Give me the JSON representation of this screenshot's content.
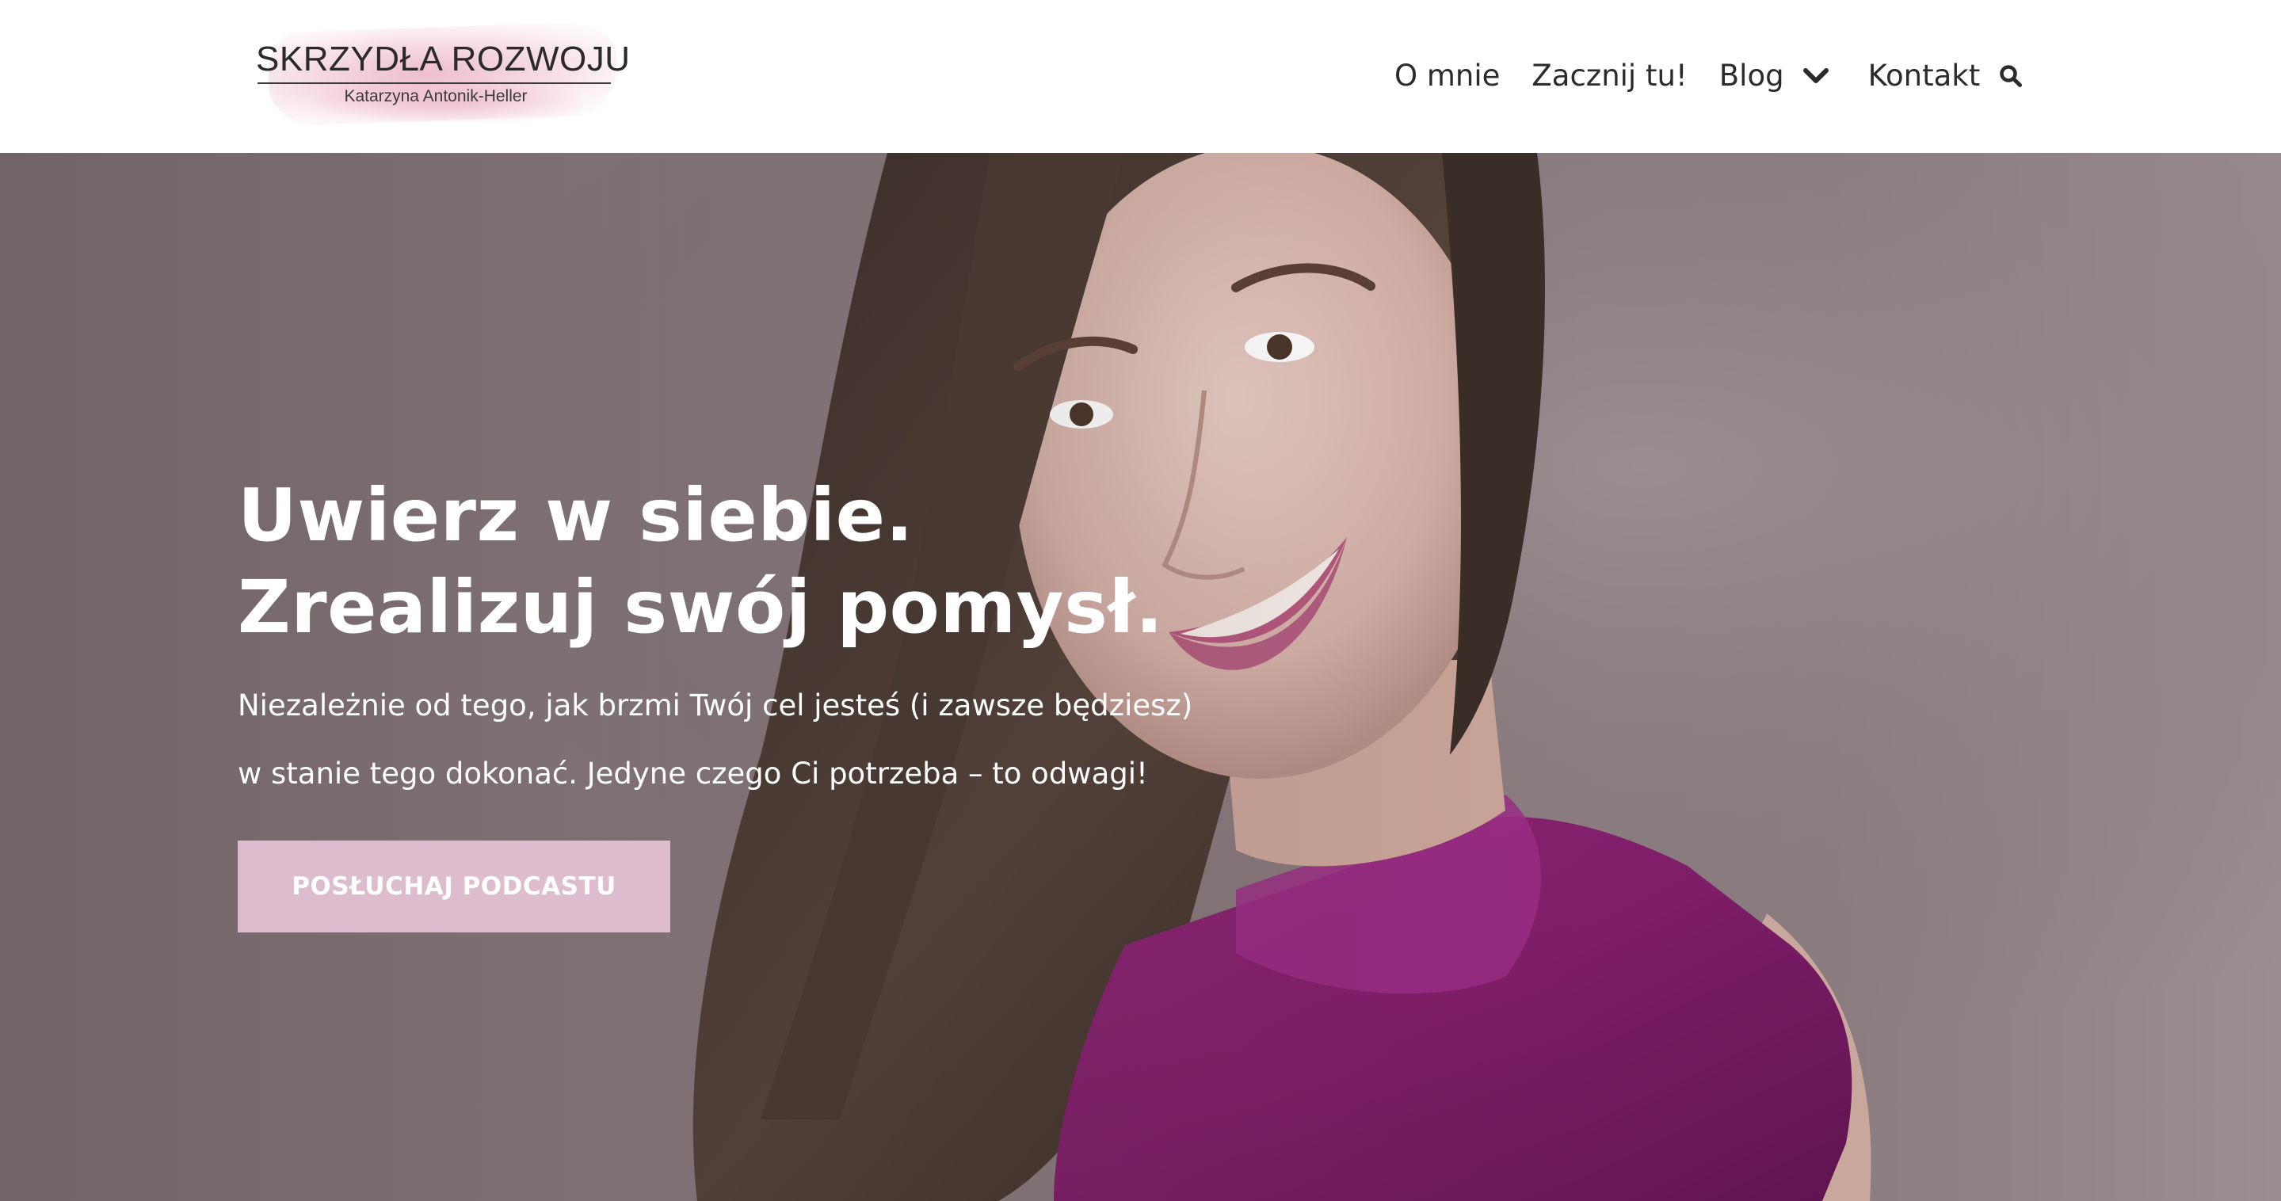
{
  "logo": {
    "title": "SKRZYDŁA ROZWOJU",
    "subtitle": "Katarzyna Antonik-Heller"
  },
  "nav": {
    "items": [
      {
        "label": "O mnie"
      },
      {
        "label": "Zacznij tu!"
      },
      {
        "label": "Blog"
      },
      {
        "label": "Kontakt"
      }
    ],
    "icons": [
      "chevron-down-icon",
      "search-icon"
    ]
  },
  "hero": {
    "title_line1": "Uwierz w siebie.",
    "title_line2": "Zrealizuj swój pomysł.",
    "text_line1": "Niezależnie od tego, jak brzmi Twój cel jesteś (i zawsze będziesz)",
    "text_line2": "w stanie tego dokonać. Jedyne czego Ci potrzeba – to odwagi!",
    "cta_label": "POSŁUCHAJ PODCASTU"
  },
  "colors": {
    "cta_background": "#dcbccd",
    "hero_background": "#857679",
    "nav_text": "#2b2b2b",
    "dress": "#7e1d68"
  }
}
